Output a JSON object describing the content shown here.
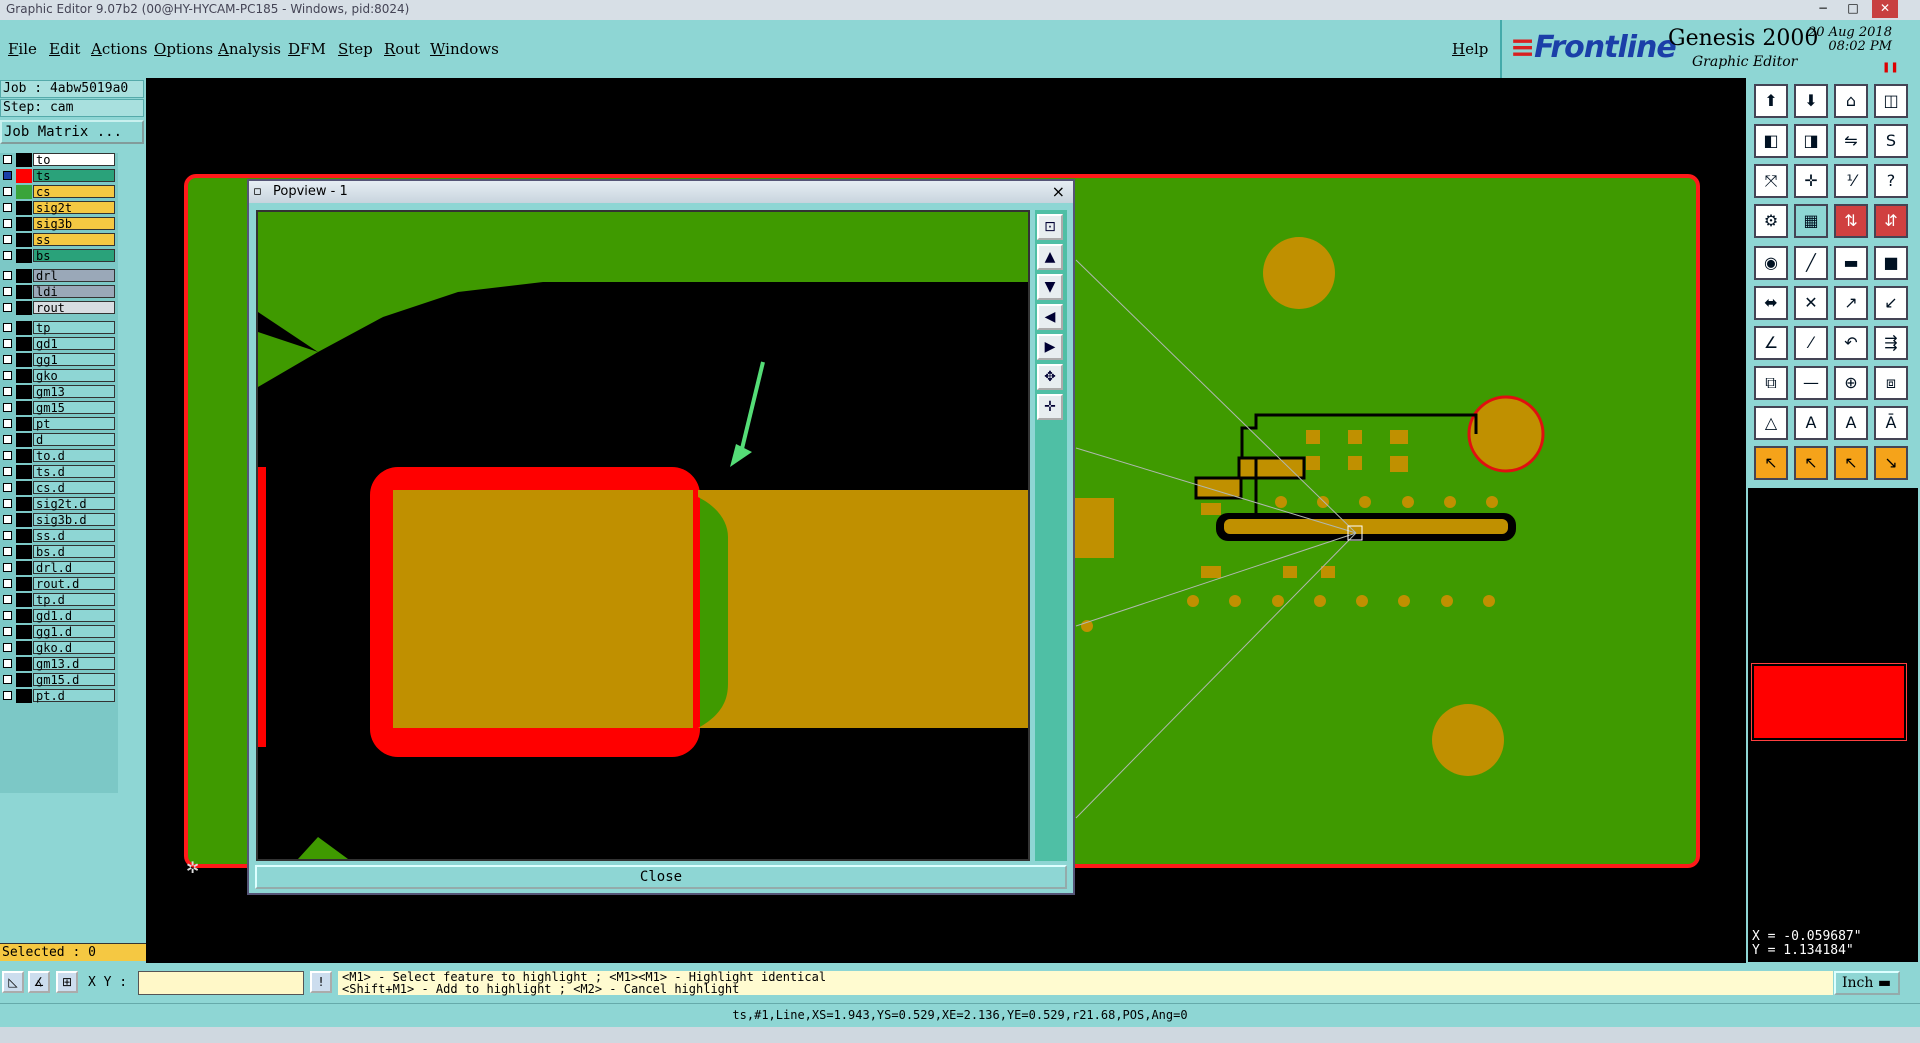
{
  "window": {
    "title": "Graphic Editor 9.07b2 (00@HY-HYCAM-PC185 - Windows, pid:8024)",
    "buttons": [
      "−",
      "□",
      "✕"
    ]
  },
  "menu": {
    "items": [
      "File",
      "Edit",
      "Actions",
      "Options",
      "Analysis",
      "DFM",
      "Step",
      "Rout",
      "Windows"
    ],
    "help": "Help"
  },
  "branding": {
    "logo": "Frontline",
    "product": "Genesis 2000",
    "subtitle": "Graphic Editor",
    "date": "20 Aug 2018",
    "time": "08:02 PM"
  },
  "job": {
    "job_label": "Job : 4abw5019a0",
    "step_label": "Step: cam",
    "matrix_button": "Job Matrix ..."
  },
  "layers": [
    {
      "name": "to",
      "color": "#ffffff",
      "swatch": "#000000",
      "checked": false
    },
    {
      "name": "ts",
      "color": "#2aa27a",
      "swatch": "#ff0000",
      "checked": true
    },
    {
      "name": "cs",
      "color": "#f5c842",
      "swatch": "#3aa43a",
      "checked": false
    },
    {
      "name": "sig2t",
      "color": "#f5c842",
      "swatch": "#000000",
      "checked": false
    },
    {
      "name": "sig3b",
      "color": "#f5c842",
      "swatch": "#000000",
      "checked": false
    },
    {
      "name": "ss",
      "color": "#f5c842",
      "swatch": "#000000",
      "checked": false
    },
    {
      "name": "bs",
      "color": "#2aa27a",
      "swatch": "#000000",
      "checked": false
    },
    {
      "name": "drl",
      "color": "#9aa8b8",
      "swatch": "#000000",
      "checked": false
    },
    {
      "name": "ldi",
      "color": "#9aa8b8",
      "swatch": "#000000",
      "checked": false
    },
    {
      "name": "rout",
      "color": "#d8dde2",
      "swatch": "#000000",
      "checked": false
    },
    {
      "name": "tp",
      "color": "#8ed6d4",
      "swatch": "#000000",
      "checked": false
    },
    {
      "name": "gd1",
      "color": "#8ed6d4",
      "swatch": "#000000",
      "checked": false
    },
    {
      "name": "gg1",
      "color": "#8ed6d4",
      "swatch": "#000000",
      "checked": false
    },
    {
      "name": "gko",
      "color": "#8ed6d4",
      "swatch": "#000000",
      "checked": false
    },
    {
      "name": "gm13",
      "color": "#8ed6d4",
      "swatch": "#000000",
      "checked": false
    },
    {
      "name": "gm15",
      "color": "#8ed6d4",
      "swatch": "#000000",
      "checked": false
    },
    {
      "name": "pt",
      "color": "#8ed6d4",
      "swatch": "#000000",
      "checked": false
    },
    {
      "name": "d",
      "color": "#8ed6d4",
      "swatch": "#000000",
      "checked": false
    },
    {
      "name": "to.d",
      "color": "#8ed6d4",
      "swatch": "#000000",
      "checked": false
    },
    {
      "name": "ts.d",
      "color": "#8ed6d4",
      "swatch": "#000000",
      "checked": false
    },
    {
      "name": "cs.d",
      "color": "#8ed6d4",
      "swatch": "#000000",
      "checked": false
    },
    {
      "name": "sig2t.d",
      "color": "#8ed6d4",
      "swatch": "#000000",
      "checked": false
    },
    {
      "name": "sig3b.d",
      "color": "#8ed6d4",
      "swatch": "#000000",
      "checked": false
    },
    {
      "name": "ss.d",
      "color": "#8ed6d4",
      "swatch": "#000000",
      "checked": false
    },
    {
      "name": "bs.d",
      "color": "#8ed6d4",
      "swatch": "#000000",
      "checked": false
    },
    {
      "name": "drl.d",
      "color": "#8ed6d4",
      "swatch": "#000000",
      "checked": false
    },
    {
      "name": "rout.d",
      "color": "#8ed6d4",
      "swatch": "#000000",
      "checked": false
    },
    {
      "name": "tp.d",
      "color": "#8ed6d4",
      "swatch": "#000000",
      "checked": false
    },
    {
      "name": "gd1.d",
      "color": "#8ed6d4",
      "swatch": "#000000",
      "checked": false
    },
    {
      "name": "gg1.d",
      "color": "#8ed6d4",
      "swatch": "#000000",
      "checked": false
    },
    {
      "name": "gko.d",
      "color": "#8ed6d4",
      "swatch": "#000000",
      "checked": false
    },
    {
      "name": "gm13.d",
      "color": "#8ed6d4",
      "swatch": "#000000",
      "checked": false
    },
    {
      "name": "gm15.d",
      "color": "#8ed6d4",
      "swatch": "#000000",
      "checked": false
    },
    {
      "name": "pt.d",
      "color": "#8ed6d4",
      "swatch": "#000000",
      "checked": false
    }
  ],
  "selected": "Selected : 0",
  "popview": {
    "title": "Popview - 1",
    "close_x": "×",
    "close_button": "Close"
  },
  "coords": {
    "x": "X = -0.059687\"",
    "y": "Y = 1.134184\""
  },
  "bottom": {
    "xy_label": "X Y :",
    "xy_input": "",
    "hint_line1": "<M1> - Select feature to highlight ; <M1><M1> - Highlight identical",
    "hint_line2": "<Shift+M1> - Add to highlight ; <M2> - Cancel highlight",
    "units": "Inch"
  },
  "status": "ts,#1,Line,XS=1.943,YS=0.529,XE=2.136,YE=0.529,r21.68,POS,Ang=0",
  "colors": {
    "board_green": "#3f9a00",
    "copper_gold": "#c09000",
    "highlight_red": "#ff0000",
    "panel_cyan": "#8ed6d4",
    "arrow_green": "#55dd77"
  }
}
